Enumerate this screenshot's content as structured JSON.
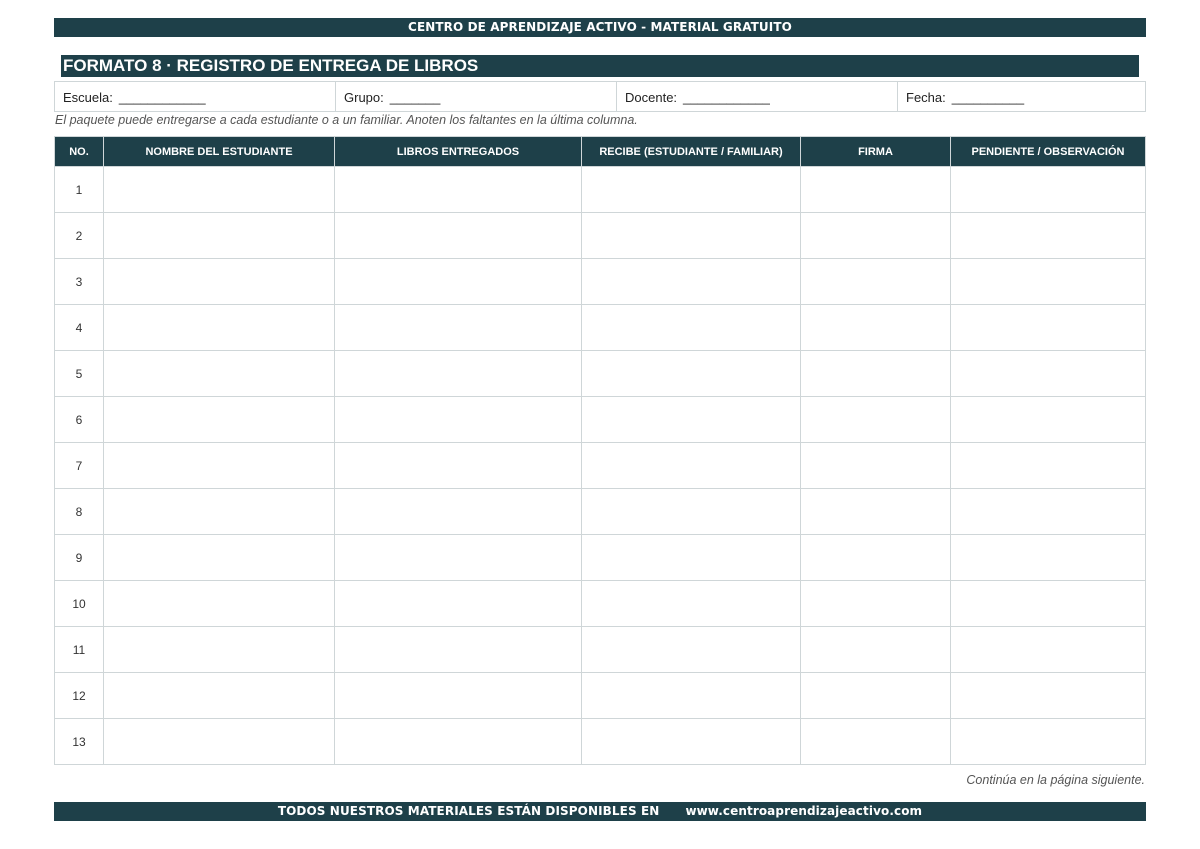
{
  "header": {
    "banner": "CENTRO DE APRENDIZAJE ACTIVO - MATERIAL GRATUITO"
  },
  "title": "FORMATO 8 · REGISTRO DE ENTREGA DE LIBROS",
  "fields": [
    {
      "label": "Escuela:",
      "blank": "____________"
    },
    {
      "label": "Grupo:",
      "blank": "_______"
    },
    {
      "label": "Docente:",
      "blank": "____________"
    },
    {
      "label": "Fecha:",
      "blank": "__________"
    }
  ],
  "note": "El paquete puede entregarse a cada estudiante o a un familiar. Anoten los faltantes en la última columna.",
  "table": {
    "columns": [
      "NO.",
      "NOMBRE DEL ESTUDIANTE",
      "LIBROS ENTREGADOS",
      "RECIBE (ESTUDIANTE / FAMILIAR)",
      "FIRMA",
      "PENDIENTE / OBSERVACIÓN"
    ],
    "rows": [
      "1",
      "2",
      "3",
      "4",
      "5",
      "6",
      "7",
      "8",
      "9",
      "10",
      "11",
      "12",
      "13"
    ]
  },
  "continue_note": "Continúa en la página siguiente.",
  "footer": {
    "text": "TODOS NUESTROS MATERIALES ESTÁN DISPONIBLES EN",
    "url": "www.centroaprendizajeactivo.com"
  }
}
